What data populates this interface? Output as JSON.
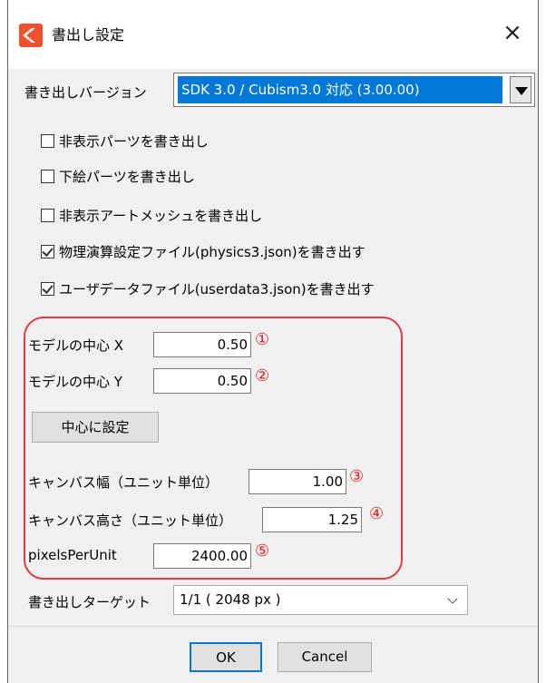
{
  "window": {
    "title": "書出し設定",
    "close_glyph": "×"
  },
  "export_version": {
    "label": "書き出しバージョン",
    "selected": "SDK 3.0 / Cubism3.0 対応 (3.00.00)"
  },
  "options": [
    {
      "label": "非表示パーツを書き出し",
      "checked": false
    },
    {
      "label": "下絵パーツを書き出し",
      "checked": false
    },
    {
      "label": "非表示アートメッシュを書き出し",
      "checked": false
    },
    {
      "label": "物理演算設定ファイル(physics3.json)を書き出す",
      "checked": true
    },
    {
      "label": "ユーザデータファイル(userdata3.json)を書き出す",
      "checked": true
    }
  ],
  "model_center_x": {
    "label": "モデルの中心 X",
    "value": "0.50",
    "marker": "①"
  },
  "model_center_y": {
    "label": "モデルの中心 Y",
    "value": "0.50",
    "marker": "②"
  },
  "set_center_button": "中心に設定",
  "canvas_width": {
    "label": "キャンバス幅（ユニット単位）",
    "value": "1.00",
    "marker": "③"
  },
  "canvas_height": {
    "label": "キャンバス高さ（ユニット単位）",
    "value": "1.25",
    "marker": "④"
  },
  "pixels_per_unit": {
    "label": "pixelsPerUnit",
    "value": "2400.00",
    "marker": "⑤"
  },
  "export_target": {
    "label": "書き出しターゲット",
    "selected": "1/1 ( 2048 px )"
  },
  "buttons": {
    "ok": "OK",
    "cancel": "Cancel"
  },
  "colors": {
    "accent": "#0078d7",
    "highlight": "#e23a44",
    "app_icon": "#f0512a"
  },
  "icons": {
    "app": "cubism-logo-icon",
    "close": "close-icon"
  }
}
